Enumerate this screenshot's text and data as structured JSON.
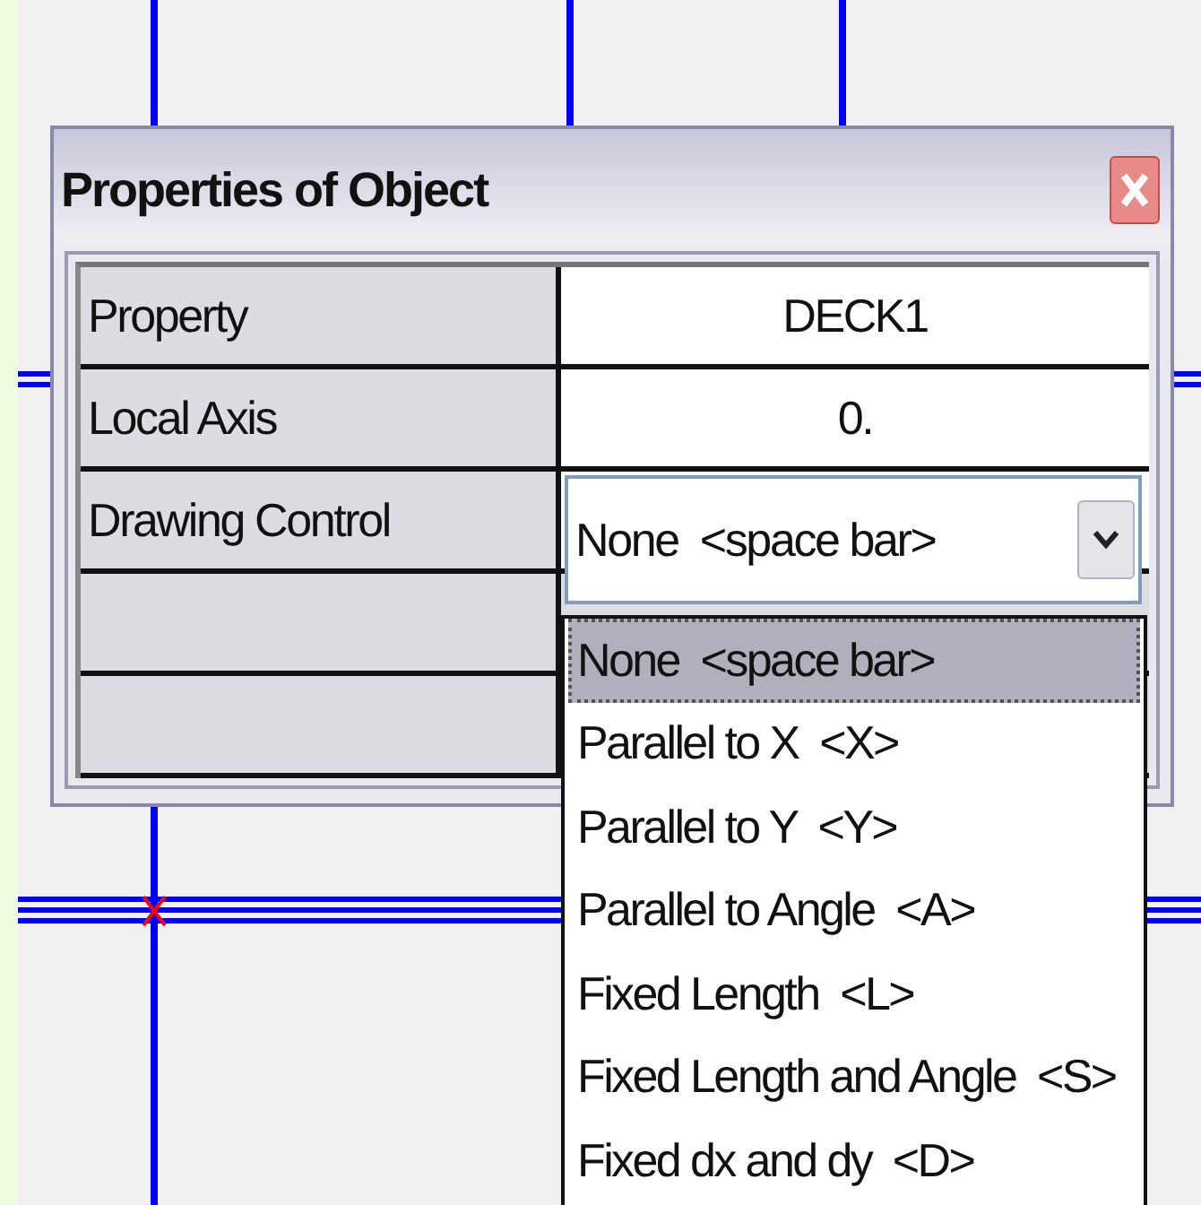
{
  "window": {
    "title": "Properties of Object"
  },
  "properties": [
    {
      "kind": "text",
      "name": "Property",
      "value": "DECK1"
    },
    {
      "kind": "text",
      "name": "Local Axis",
      "value": "0."
    },
    {
      "kind": "dropdown",
      "name": "Drawing Control",
      "value": "None  <space bar>",
      "expanded": true
    },
    {
      "kind": "blank"
    },
    {
      "kind": "blank"
    }
  ],
  "dropdown_options": [
    {
      "label": "None  <space bar>",
      "selected": true
    },
    {
      "label": "Parallel to X  <X>",
      "selected": false
    },
    {
      "label": "Parallel to Y  <Y>",
      "selected": false
    },
    {
      "label": "Parallel to Angle  <A>",
      "selected": false
    },
    {
      "label": "Fixed Length  <L>",
      "selected": false
    },
    {
      "label": "Fixed Length and Angle  <S>",
      "selected": false
    },
    {
      "label": "Fixed dx and dy  <D>",
      "selected": false
    }
  ]
}
